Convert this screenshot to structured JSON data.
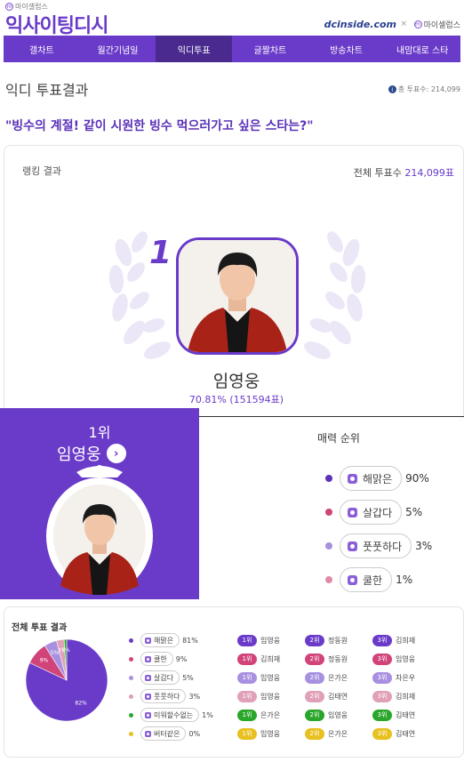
{
  "header": {
    "brand_small": "마이셀럽스",
    "logo": "익사이팅디시",
    "partner": "dcinside.com",
    "partner_prefix": "dc",
    "separator": "×",
    "partner2": "마이셀럽스"
  },
  "nav": {
    "items": [
      "갤차트",
      "월간기념일",
      "익디투표",
      "글짤차트",
      "방송차트",
      "내맘대로 스타"
    ],
    "active_index": 2
  },
  "page": {
    "title": "익디 투표결과",
    "total_small": "총 투표수: 214,099",
    "question": "\"빙수의 계절! 같이 시원한 빙수 먹으러가고 싶은 스타는?\""
  },
  "ranking": {
    "label": "랭킹 결과",
    "total_label": "전체 투표수",
    "total_value": "214,099표",
    "rank_number": "1",
    "winner_name": "임영웅",
    "winner_pct": "70.81% (151594표)"
  },
  "panel": {
    "rank": "1위",
    "name": "임영웅",
    "arrow": "›"
  },
  "charm": {
    "title": "매력 순위",
    "items": [
      {
        "label": "해맑은",
        "pct": "90%",
        "color": "#5b32b8"
      },
      {
        "label": "살갑다",
        "pct": "5%",
        "color": "#d0447a"
      },
      {
        "label": "풋풋하다",
        "pct": "3%",
        "color": "#a890e0"
      },
      {
        "label": "쿨한",
        "pct": "1%",
        "color": "#e08aa8"
      }
    ]
  },
  "overall": {
    "title": "전체 투표 결과",
    "items": [
      {
        "label": "해맑은",
        "pct": "81%",
        "color": "#6a3bc9",
        "ranks": [
          "임영웅",
          "정동원",
          "김희재"
        ]
      },
      {
        "label": "쿨한",
        "pct": "9%",
        "color": "#d0447a",
        "ranks": [
          "김희재",
          "정동원",
          "임영웅"
        ]
      },
      {
        "label": "살갑다",
        "pct": "5%",
        "color": "#a890e0",
        "ranks": [
          "임영웅",
          "은가은",
          "차은우"
        ]
      },
      {
        "label": "풋풋하다",
        "pct": "3%",
        "color": "#e0a0b8",
        "ranks": [
          "임영웅",
          "김태연",
          "김희재"
        ]
      },
      {
        "label": "미워할수없는",
        "pct": "1%",
        "color": "#2aa62a",
        "ranks": [
          "은가은",
          "임영웅",
          "김태연"
        ]
      },
      {
        "label": "버터같은",
        "pct": "0%",
        "color": "#e8c020",
        "ranks": [
          "임영웅",
          "은가은",
          "김태연"
        ]
      }
    ],
    "rank_labels": [
      "1위",
      "2위",
      "3위"
    ],
    "pie_labels": [
      "82%",
      "9%",
      "5%",
      "3%",
      "1%"
    ],
    "pie_values": [
      82,
      9,
      5,
      3,
      1
    ]
  }
}
